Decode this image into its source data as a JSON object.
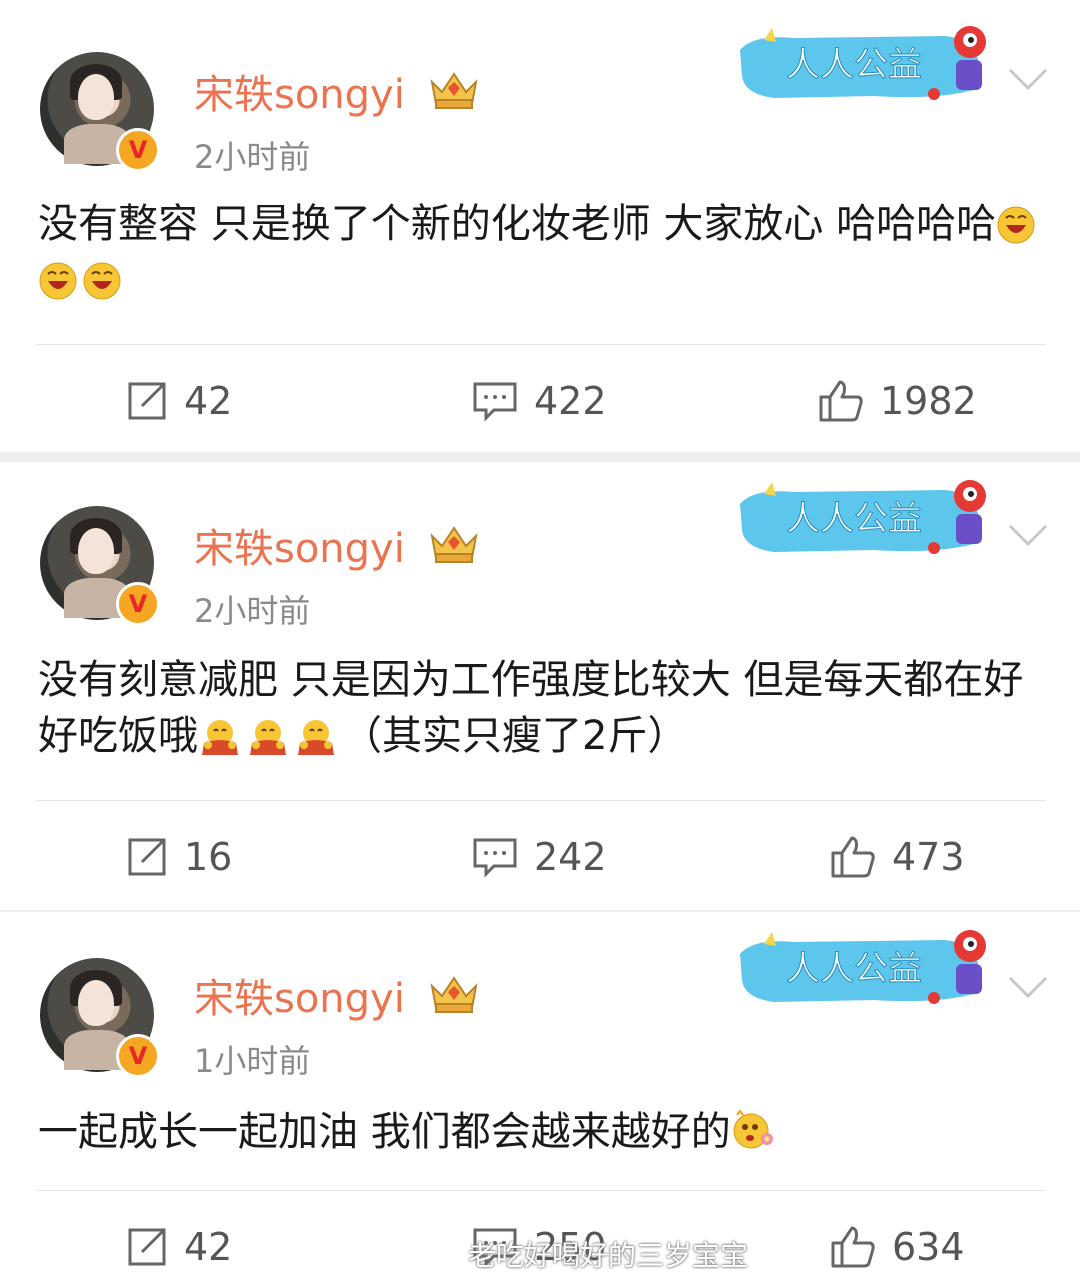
{
  "posts": [
    {
      "username": "宋轶songyi",
      "time": "2小时前",
      "content": "没有整容 只是换了个新的化妆老师 大家放心 哈哈哈哈",
      "verified_badge": "V",
      "promo_label": "人人公益",
      "repost_count": "42",
      "comment_count": "422",
      "like_count": "1982"
    },
    {
      "username": "宋轶songyi",
      "time": "2小时前",
      "content": "没有刻意减肥 只是因为工作强度比较大 但是每天都在好好吃饭哦",
      "content_suffix": "（其实只瘦了2斤）",
      "verified_badge": "V",
      "promo_label": "人人公益",
      "repost_count": "16",
      "comment_count": "242",
      "like_count": "473"
    },
    {
      "username": "宋轶songyi",
      "time": "1小时前",
      "content": "一起成长一起加油 我们都会越来越好的",
      "verified_badge": "V",
      "promo_label": "人人公益",
      "repost_count": "42",
      "comment_count": "250",
      "like_count": "634"
    }
  ],
  "watermark": "老吃好喝好的三岁宝宝",
  "colors": {
    "username": "#eb7350",
    "time": "#8a8a8a",
    "badge": "#f5a623",
    "promo": "#4fc3e8"
  },
  "icons": [
    "avatar",
    "verified-v-icon",
    "crown-icon",
    "promo-banner",
    "chevron-down-icon",
    "repost-icon",
    "comment-icon",
    "like-icon",
    "laugh-emoji",
    "hug-emoji",
    "flower-emoji"
  ]
}
